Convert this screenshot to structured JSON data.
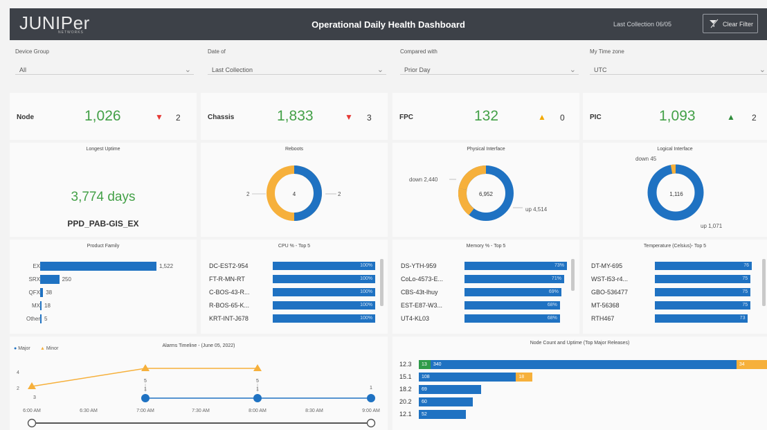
{
  "header": {
    "logo": "JUNIPer",
    "logo_sub": "NETWORKS",
    "title": "Operational Daily Health Dashboard",
    "last_collection": "Last Collection 06/05",
    "clear_filter": "Clear Filter"
  },
  "filters": [
    {
      "label": "Device Group",
      "value": "All"
    },
    {
      "label": "Date of",
      "value": "Last Collection"
    },
    {
      "label": "Compared with",
      "value": "Prior Day"
    },
    {
      "label": "My Time zone",
      "value": "UTC"
    }
  ],
  "kpis": [
    {
      "label": "Node",
      "value": "1,026",
      "arrow": "▼",
      "arrow_color": "#e53935",
      "delta": "2"
    },
    {
      "label": "Chassis",
      "value": "1,833",
      "arrow": "▼",
      "arrow_color": "#e53935",
      "delta": "3"
    },
    {
      "label": "FPC",
      "value": "132",
      "arrow": "▲",
      "arrow_color": "#f2a900",
      "delta": "0"
    },
    {
      "label": "PIC",
      "value": "1,093",
      "arrow": "▲",
      "arrow_color": "#2e8b3a",
      "delta": "2"
    }
  ],
  "uptime": {
    "title": "Longest Uptime",
    "value": "3,774 days",
    "host": "PPD_PAB-GIS_EX"
  },
  "reboots": {
    "title": "Reboots",
    "center": "4",
    "left": "2",
    "right": "2"
  },
  "physical": {
    "title": "Physical Interface",
    "center": "6,952",
    "down": "down 2,440",
    "up": "up 4,514"
  },
  "logical": {
    "title": "Logical Interface",
    "center": "1,116",
    "down": "down 45",
    "up": "up 1,071"
  },
  "product_family": {
    "title": "Product Family",
    "rows": [
      {
        "name": "EX",
        "value": "1,522"
      },
      {
        "name": "SRX",
        "value": "250"
      },
      {
        "name": "QFX",
        "value": "38"
      },
      {
        "name": "MX",
        "value": "18"
      },
      {
        "name": "Other",
        "value": "5"
      }
    ]
  },
  "cpu": {
    "title": "CPU % - Top 5",
    "rows": [
      {
        "name": "DC-EST2-954",
        "value": "100%"
      },
      {
        "name": "FT-R-MN-RT",
        "value": "100%"
      },
      {
        "name": "C-BOS-43-R...",
        "value": "100%"
      },
      {
        "name": "R-BOS-65-K...",
        "value": "100%"
      },
      {
        "name": "KRT-INT-J678",
        "value": "100%"
      }
    ]
  },
  "memory": {
    "title": "Memory % - Top 5",
    "rows": [
      {
        "name": "DS-YTH-959",
        "value": "73%"
      },
      {
        "name": "CoLo-4573-E...",
        "value": "71%"
      },
      {
        "name": "CBS-43t-lhuy",
        "value": "69%"
      },
      {
        "name": "EST-E87-W3...",
        "value": "68%"
      },
      {
        "name": "UT4-KL03",
        "value": "68%"
      }
    ]
  },
  "temperature": {
    "title": "Temperature (Celsius)- Top 5",
    "rows": [
      {
        "name": "DT-MY-695",
        "value": "76"
      },
      {
        "name": "WST-l53-r4...",
        "value": "75"
      },
      {
        "name": "GBO-536477",
        "value": "75"
      },
      {
        "name": "MT-56368",
        "value": "75"
      },
      {
        "name": "RTH467",
        "value": "73"
      }
    ]
  },
  "alarms": {
    "title": "Alarms Timeline - (June 05, 2022)",
    "legend_major": "Major",
    "legend_minor": "Minor",
    "y_ticks": [
      "4",
      "2"
    ],
    "x_ticks": [
      "6:00 AM",
      "6:30 AM",
      "7:00 AM",
      "7:30 AM",
      "8:00 AM",
      "8:30 AM",
      "9:00 AM"
    ],
    "minor_values": [
      "3",
      "5",
      "5"
    ],
    "major_values": [
      "1",
      "1",
      "1"
    ]
  },
  "releases": {
    "title": "Node Count and Uptime (Top Major Releases)",
    "rows": [
      {
        "name": "12.3",
        "a": "13",
        "b": "340",
        "c": "34"
      },
      {
        "name": "15.1",
        "a": "",
        "b": "108",
        "c": "18"
      },
      {
        "name": "18.2",
        "a": "",
        "b": "69",
        "c": ""
      },
      {
        "name": "20.2",
        "a": "",
        "b": "60",
        "c": ""
      },
      {
        "name": "12.1",
        "a": "",
        "b": "52",
        "c": ""
      }
    ]
  },
  "colors": {
    "green": "#43a047",
    "blue": "#1f72c2",
    "orange": "#f6b03b"
  },
  "chart_data": [
    {
      "type": "bar",
      "title": "Product Family",
      "categories": [
        "EX",
        "SRX",
        "QFX",
        "MX",
        "Other"
      ],
      "values": [
        1522,
        250,
        38,
        18,
        5
      ]
    },
    {
      "type": "bar",
      "title": "CPU % - Top 5",
      "categories": [
        "DC-EST2-954",
        "FT-R-MN-RT",
        "C-BOS-43-R...",
        "R-BOS-65-K...",
        "KRT-INT-J678"
      ],
      "values": [
        100,
        100,
        100,
        100,
        100
      ]
    },
    {
      "type": "bar",
      "title": "Memory % - Top 5",
      "categories": [
        "DS-YTH-959",
        "CoLo-4573-E...",
        "CBS-43t-lhuy",
        "EST-E87-W3...",
        "UT4-KL03"
      ],
      "values": [
        73,
        71,
        69,
        68,
        68
      ]
    },
    {
      "type": "bar",
      "title": "Temperature (Celsius)- Top 5",
      "categories": [
        "DT-MY-695",
        "WST-l53-r4...",
        "GBO-536477",
        "MT-56368",
        "RTH467"
      ],
      "values": [
        76,
        75,
        75,
        75,
        73
      ]
    },
    {
      "type": "pie",
      "title": "Reboots",
      "categories": [
        "left",
        "right"
      ],
      "values": [
        2,
        2
      ]
    },
    {
      "type": "pie",
      "title": "Physical Interface",
      "categories": [
        "down",
        "up"
      ],
      "values": [
        2440,
        4514
      ]
    },
    {
      "type": "pie",
      "title": "Logical Interface",
      "categories": [
        "down",
        "up"
      ],
      "values": [
        45,
        1071
      ]
    },
    {
      "type": "line",
      "title": "Alarms Timeline - (June 05, 2022)",
      "series": [
        {
          "name": "Minor",
          "x": [
            "6:00 AM",
            "7:00 AM",
            "8:00 AM"
          ],
          "values": [
            3,
            5,
            5
          ]
        },
        {
          "name": "Major",
          "x": [
            "7:00 AM",
            "8:00 AM",
            "9:00 AM"
          ],
          "values": [
            1,
            1,
            1
          ]
        }
      ]
    },
    {
      "type": "bar",
      "title": "Node Count and Uptime (Top Major Releases)",
      "categories": [
        "12.3",
        "15.1",
        "18.2",
        "20.2",
        "12.1"
      ],
      "series": [
        {
          "values": [
            13,
            0,
            0,
            0,
            0
          ]
        },
        {
          "values": [
            340,
            108,
            69,
            60,
            52
          ]
        },
        {
          "values": [
            34,
            18,
            0,
            0,
            0
          ]
        }
      ]
    }
  ]
}
